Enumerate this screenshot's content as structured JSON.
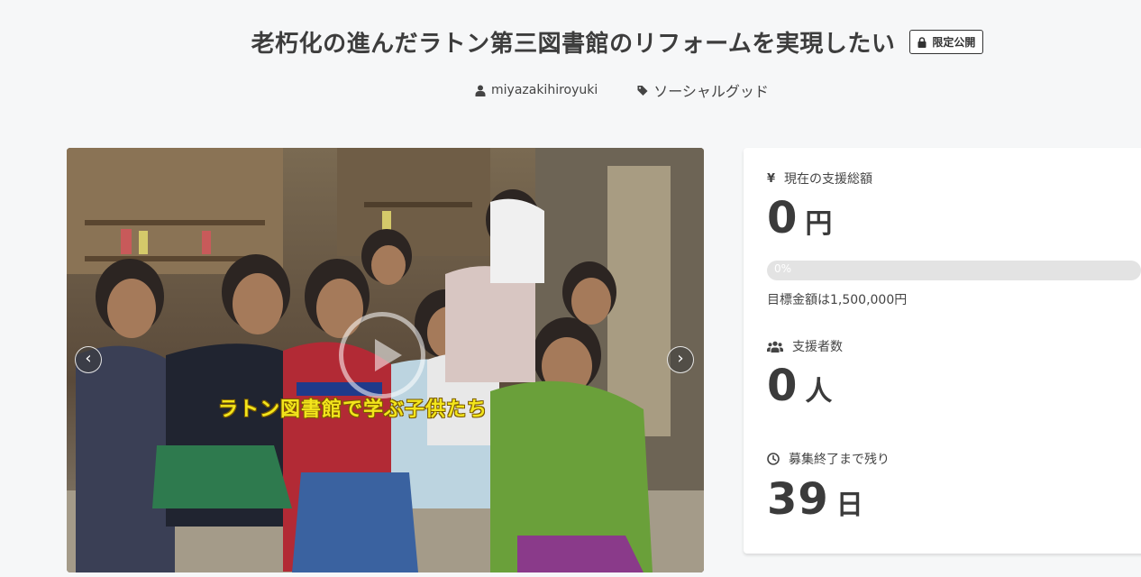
{
  "project": {
    "title": "老朽化の進んだラトン第三図書館のリフォームを実現したい",
    "badge": "限定公開",
    "author": "miyazakihiroyuki",
    "category": "ソーシャルグッド"
  },
  "media": {
    "caption": "ラトン図書館で学ぶ子供たち",
    "prev_label": "‹",
    "next_label": "›"
  },
  "stats": {
    "raised_label": "現在の支援総額",
    "raised_value": "0",
    "raised_unit": "円",
    "progress_percent": 0,
    "progress_text": "0%",
    "goal_text": "目標金額は1,500,000円",
    "supporters_label": "支援者数",
    "supporters_value": "0",
    "supporters_unit": "人",
    "remaining_label": "募集終了まで残り",
    "remaining_value": "39",
    "remaining_unit": "日"
  },
  "icons": {
    "lock": "lock-icon",
    "user": "user-icon",
    "tag": "tag-icon",
    "yen": "yen-icon",
    "users": "users-icon",
    "clock": "clock-icon"
  }
}
